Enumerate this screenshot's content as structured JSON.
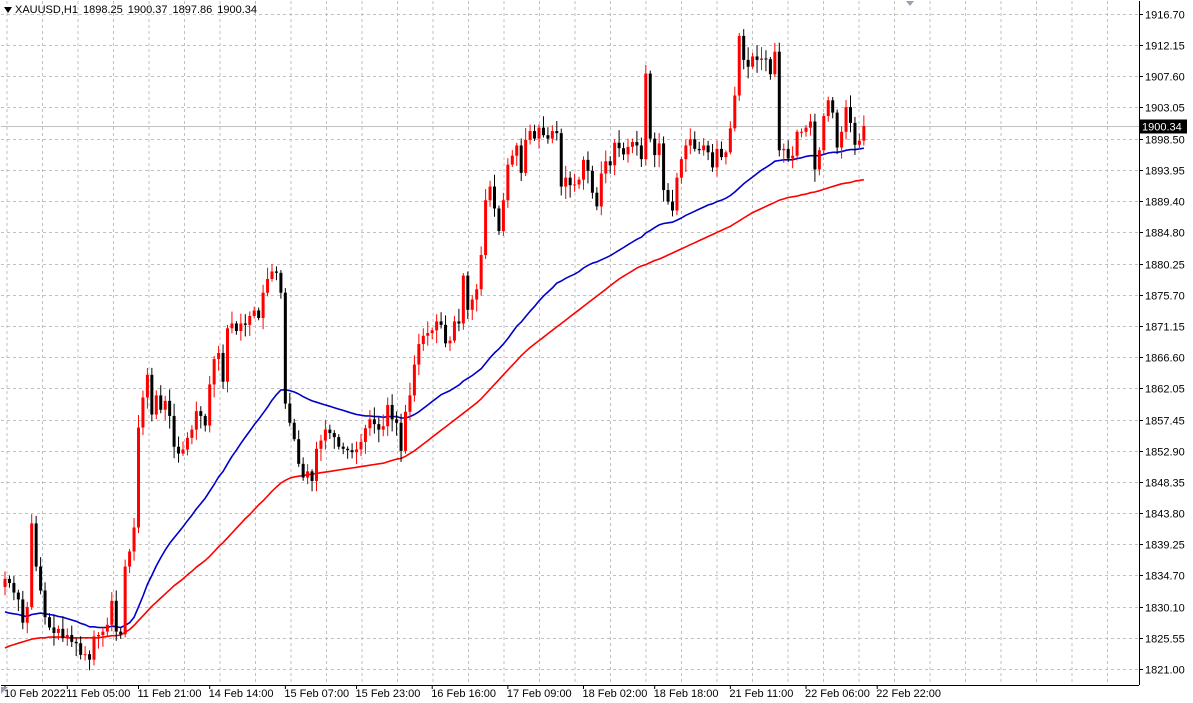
{
  "header": {
    "symbol": "XAUUSD,H1",
    "open": "1898.25",
    "high": "1900.37",
    "low": "1897.86",
    "close": "1900.34"
  },
  "colors": {
    "background": "#ffffff",
    "grid": "#c0c0c0",
    "bull": "#ff0000",
    "bear": "#000000",
    "ma_fast": "#0000c8",
    "ma_slow": "#ff0000",
    "current_price_line": "#c0c0c0",
    "current_price_box": "#000000"
  },
  "chart_data": {
    "type": "candlestick",
    "title": "XAUUSD,H1",
    "current_price": 1900.34,
    "grid": true,
    "ylim": [
      1818.7,
      1918.6
    ],
    "y_ticks": [
      "1916.70",
      "1912.15",
      "1907.60",
      "1903.05",
      "1898.50",
      "1893.95",
      "1889.40",
      "1884.80",
      "1880.25",
      "1875.70",
      "1871.15",
      "1866.60",
      "1862.05",
      "1857.45",
      "1852.90",
      "1848.35",
      "1843.80",
      "1839.25",
      "1834.70",
      "1830.10",
      "1825.55",
      "1821.00"
    ],
    "x_labels": [
      {
        "label": "10 Feb 2022",
        "bar": 0
      },
      {
        "label": "11 Feb 05:00",
        "bar": 14
      },
      {
        "label": "11 Feb 21:00",
        "bar": 30
      },
      {
        "label": "14 Feb 14:00",
        "bar": 46
      },
      {
        "label": "15 Feb 07:00",
        "bar": 63
      },
      {
        "label": "15 Feb 23:00",
        "bar": 79
      },
      {
        "label": "16 Feb 16:00",
        "bar": 96
      },
      {
        "label": "17 Feb 09:00",
        "bar": 113
      },
      {
        "label": "18 Feb 02:00",
        "bar": 130
      },
      {
        "label": "18 Feb 18:00",
        "bar": 146
      },
      {
        "label": "21 Feb 11:00",
        "bar": 163
      },
      {
        "label": "22 Feb 06:00",
        "bar": 180
      },
      {
        "label": "22 Feb 22:00",
        "bar": 196
      }
    ],
    "closes": [
      1834.2,
      1833.6,
      1832.2,
      1831.2,
      1827.8,
      1830.1,
      1842.3,
      1836.0,
      1832.5,
      1828.6,
      1827.1,
      1826.3,
      1826.9,
      1825.6,
      1826.0,
      1825.0,
      1824.8,
      1823.1,
      1823.2,
      1822.4,
      1825.8,
      1826.0,
      1826.5,
      1827.5,
      1831.0,
      1826.5,
      1826.1,
      1836.0,
      1838.2,
      1841.7,
      1856.3,
      1860.7,
      1864.0,
      1858.2,
      1861.0,
      1858.9,
      1860.2,
      1858.0,
      1853.5,
      1852.5,
      1853.1,
      1854.8,
      1856.0,
      1858.7,
      1858.0,
      1856.6,
      1862.6,
      1866.3,
      1867.2,
      1863.0,
      1870.8,
      1871.5,
      1870.4,
      1871.5,
      1871.3,
      1872.6,
      1873.4,
      1872.3,
      1876.0,
      1878.0,
      1879.1,
      1878.9,
      1876.0,
      1859.8,
      1857.0,
      1854.6,
      1851.0,
      1849.0,
      1849.9,
      1848.5,
      1853.2,
      1854.4,
      1856.0,
      1855.5,
      1854.9,
      1853.5,
      1853.2,
      1853.0,
      1852.7,
      1853.1,
      1854.2,
      1856.2,
      1857.5,
      1856.8,
      1856.0,
      1856.5,
      1859.6,
      1857.5,
      1857.0,
      1852.9,
      1858.6,
      1861.0,
      1865.5,
      1868.5,
      1869.7,
      1870.1,
      1870.5,
      1871.8,
      1871.3,
      1868.6,
      1869.0,
      1871.8,
      1871.5,
      1878.5,
      1873.5,
      1875.0,
      1876.5,
      1881.5,
      1889.5,
      1891.5,
      1888.3,
      1885.0,
      1889.5,
      1894.7,
      1896.0,
      1897.5,
      1893.5,
      1898.3,
      1899.6,
      1898.5,
      1900.1,
      1899.0,
      1898.5,
      1899.6,
      1899.3,
      1891.5,
      1892.8,
      1891.7,
      1891.8,
      1892.5,
      1895.4,
      1893.8,
      1890.6,
      1888.6,
      1893.4,
      1895.2,
      1894.6,
      1897.9,
      1897.1,
      1896.2,
      1897.3,
      1898.0,
      1897.5,
      1895.5,
      1908.0,
      1898.5,
      1896.1,
      1897.8,
      1891.0,
      1889.3,
      1888.0,
      1892.8,
      1895.5,
      1897.5,
      1898.4,
      1897.0,
      1896.8,
      1897.5,
      1896.5,
      1894.3,
      1897.0,
      1895.8,
      1896.5,
      1900.0,
      1904.8,
      1913.5,
      1910.0,
      1909.0,
      1910.5,
      1910.0,
      1910.2,
      1910.1,
      1907.9,
      1911.2,
      1896.8,
      1897.0,
      1895.6,
      1896.0,
      1899.5,
      1899.5,
      1900.1,
      1901.0,
      1894.0,
      1896.8,
      1901.8,
      1904.1,
      1902.3,
      1897.2,
      1899.5,
      1903.1,
      1900.8,
      1897.6,
      1898.2,
      1900.34
    ]
  },
  "ma_fast": [
    1829.4,
    1829.2,
    1829.1,
    1829.0,
    1828.8,
    1828.7,
    1829.0,
    1829.1,
    1829.2,
    1829.1,
    1829.0,
    1828.9,
    1828.7,
    1828.6,
    1828.4,
    1828.2,
    1828.0,
    1827.7,
    1827.5,
    1827.2,
    1827.2,
    1827.1,
    1827.1,
    1827.1,
    1827.3,
    1827.2,
    1827.1,
    1827.4,
    1827.8,
    1828.6,
    1830.1,
    1831.7,
    1833.4,
    1834.7,
    1836.1,
    1837.3,
    1838.4,
    1839.4,
    1840.2,
    1841.0,
    1841.8,
    1842.7,
    1843.5,
    1844.4,
    1845.2,
    1846.0,
    1847.0,
    1848.0,
    1849.1,
    1849.9,
    1851.0,
    1852.1,
    1853.0,
    1854.0,
    1854.9,
    1855.8,
    1856.7,
    1857.5,
    1858.4,
    1859.3,
    1860.3,
    1861.1,
    1861.8,
    1861.8,
    1861.7,
    1861.5,
    1861.2,
    1860.8,
    1860.5,
    1860.2,
    1860.0,
    1859.8,
    1859.6,
    1859.4,
    1859.2,
    1859.0,
    1858.8,
    1858.6,
    1858.4,
    1858.2,
    1858.1,
    1858.0,
    1858.0,
    1857.9,
    1857.9,
    1857.8,
    1857.9,
    1857.9,
    1857.9,
    1857.7,
    1857.7,
    1857.9,
    1858.2,
    1858.6,
    1859.1,
    1859.6,
    1860.1,
    1860.6,
    1861.1,
    1861.4,
    1861.7,
    1862.1,
    1862.5,
    1863.1,
    1863.5,
    1863.9,
    1864.4,
    1864.9,
    1865.7,
    1866.5,
    1867.2,
    1867.8,
    1868.5,
    1869.3,
    1870.2,
    1871.1,
    1871.7,
    1872.5,
    1873.3,
    1874.0,
    1874.8,
    1875.5,
    1876.1,
    1876.7,
    1877.4,
    1877.7,
    1878.1,
    1878.4,
    1878.7,
    1879.1,
    1879.6,
    1880.0,
    1880.3,
    1880.5,
    1880.8,
    1881.1,
    1881.4,
    1881.8,
    1882.2,
    1882.6,
    1883.0,
    1883.4,
    1883.8,
    1884.1,
    1884.7,
    1885.1,
    1885.5,
    1885.9,
    1886.1,
    1886.2,
    1886.3,
    1886.6,
    1886.9,
    1887.3,
    1887.6,
    1887.9,
    1888.2,
    1888.5,
    1888.8,
    1889.0,
    1889.3,
    1889.5,
    1889.8,
    1890.2,
    1890.7,
    1891.3,
    1891.9,
    1892.4,
    1892.9,
    1893.4,
    1893.9,
    1894.3,
    1894.7,
    1895.2,
    1895.3,
    1895.4,
    1895.4,
    1895.4,
    1895.6,
    1895.7,
    1895.9,
    1896.0,
    1896.0,
    1896.0,
    1896.2,
    1896.4,
    1896.5,
    1896.5,
    1896.6,
    1896.8,
    1896.9,
    1896.9,
    1897.0,
    1897.1
  ],
  "ma_slow": [
    1824.1,
    1824.4,
    1824.6,
    1824.8,
    1825.0,
    1825.2,
    1825.4,
    1825.5,
    1825.6,
    1825.6,
    1825.7,
    1825.7,
    1825.7,
    1825.7,
    1825.6,
    1825.6,
    1825.6,
    1825.6,
    1825.6,
    1825.6,
    1825.6,
    1825.6,
    1825.7,
    1825.8,
    1825.9,
    1825.9,
    1826.0,
    1826.4,
    1826.8,
    1827.4,
    1828.1,
    1828.8,
    1829.5,
    1830.2,
    1830.8,
    1831.4,
    1832.0,
    1832.6,
    1833.2,
    1833.7,
    1834.2,
    1834.8,
    1835.3,
    1835.9,
    1836.4,
    1836.9,
    1837.5,
    1838.2,
    1838.9,
    1839.5,
    1840.2,
    1840.9,
    1841.6,
    1842.3,
    1843.0,
    1843.6,
    1844.3,
    1845.0,
    1845.6,
    1846.3,
    1847.0,
    1847.6,
    1848.2,
    1848.6,
    1848.9,
    1849.1,
    1849.2,
    1849.3,
    1849.4,
    1849.5,
    1849.6,
    1849.7,
    1849.8,
    1849.9,
    1850.0,
    1850.1,
    1850.2,
    1850.3,
    1850.4,
    1850.5,
    1850.6,
    1850.7,
    1850.8,
    1850.9,
    1851.0,
    1851.1,
    1851.3,
    1851.5,
    1851.7,
    1851.8,
    1852.1,
    1852.5,
    1852.9,
    1853.4,
    1853.9,
    1854.4,
    1854.9,
    1855.4,
    1855.9,
    1856.4,
    1856.9,
    1857.4,
    1857.9,
    1858.4,
    1858.9,
    1859.4,
    1859.9,
    1860.5,
    1861.2,
    1861.9,
    1862.6,
    1863.3,
    1864.0,
    1864.7,
    1865.4,
    1866.1,
    1866.8,
    1867.4,
    1868.0,
    1868.5,
    1869.0,
    1869.5,
    1870.0,
    1870.5,
    1871.0,
    1871.5,
    1872.0,
    1872.5,
    1873.0,
    1873.5,
    1874.0,
    1874.5,
    1875.0,
    1875.5,
    1876.0,
    1876.5,
    1877.0,
    1877.5,
    1878.0,
    1878.4,
    1878.8,
    1879.2,
    1879.6,
    1879.9,
    1880.1,
    1880.4,
    1880.7,
    1880.9,
    1881.2,
    1881.5,
    1881.8,
    1882.1,
    1882.4,
    1882.7,
    1883.0,
    1883.3,
    1883.6,
    1883.9,
    1884.2,
    1884.5,
    1884.8,
    1885.1,
    1885.4,
    1885.7,
    1886.1,
    1886.5,
    1886.9,
    1887.3,
    1887.7,
    1888.0,
    1888.3,
    1888.6,
    1888.9,
    1889.2,
    1889.5,
    1889.7,
    1889.9,
    1890.0,
    1890.1,
    1890.3,
    1890.4,
    1890.6,
    1890.7,
    1890.9,
    1891.1,
    1891.3,
    1891.5,
    1891.7,
    1891.9,
    1892.0,
    1892.1,
    1892.3,
    1892.4,
    1892.5
  ]
}
